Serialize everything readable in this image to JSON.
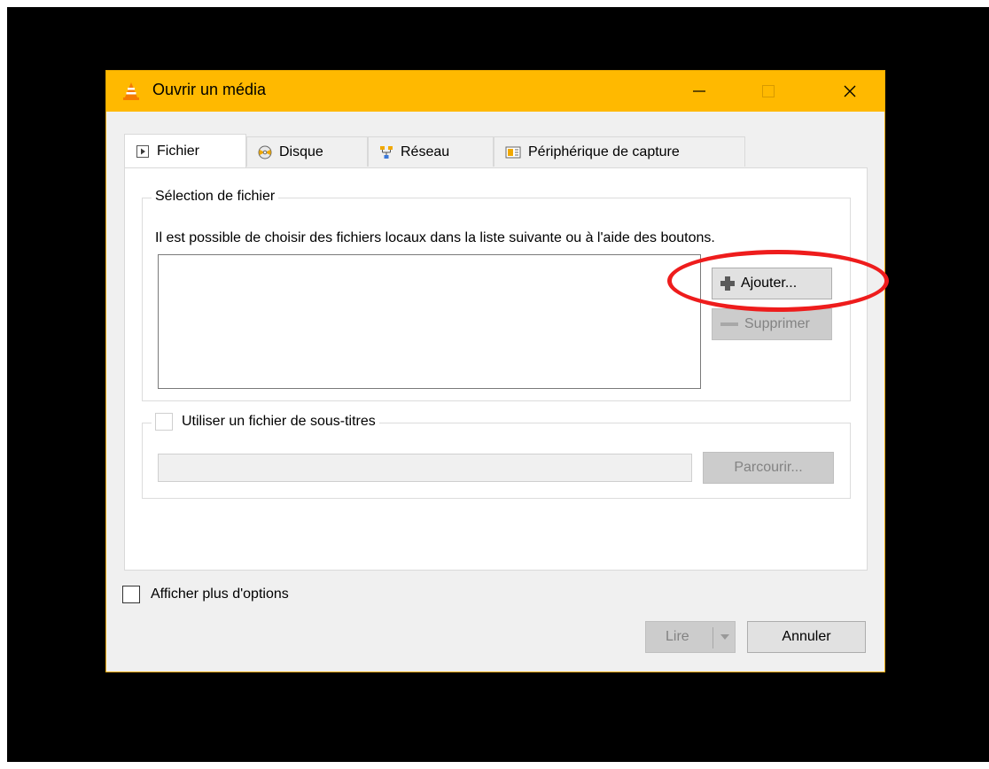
{
  "window": {
    "title": "Ouvrir un média"
  },
  "tabs": [
    {
      "label": "Fichier",
      "icon": "play-file-icon",
      "active": true
    },
    {
      "label": "Disque",
      "icon": "disc-icon",
      "active": false
    },
    {
      "label": "Réseau",
      "icon": "network-icon",
      "active": false
    },
    {
      "label": "Périphérique de capture",
      "icon": "capture-device-icon",
      "active": false
    }
  ],
  "file_selection": {
    "title": "Sélection de fichier",
    "description": "Il est possible de choisir des fichiers locaux dans la liste suivante ou à l'aide des boutons.",
    "add_label": "Ajouter...",
    "remove_label": "Supprimer"
  },
  "subtitles": {
    "checkbox_label": "Utiliser un fichier de sous-titres",
    "browse_label": "Parcourir..."
  },
  "more_options_label": "Afficher plus d'options",
  "footer": {
    "play_label": "Lire",
    "cancel_label": "Annuler"
  },
  "colors": {
    "titlebar": "#ffb900",
    "highlight": "#ee1c1c"
  }
}
